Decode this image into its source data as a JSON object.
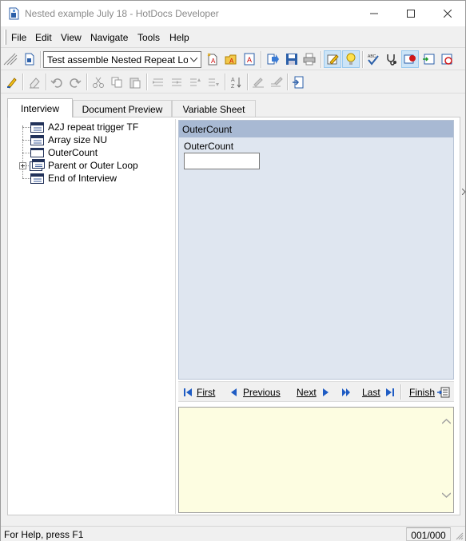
{
  "window": {
    "title": "Nested example July 18 - HotDocs Developer"
  },
  "menu": [
    "File",
    "Edit",
    "View",
    "Navigate",
    "Tools",
    "Help"
  ],
  "toolbar": {
    "assemble_combo_value": "Test assemble Nested Repeat Loo"
  },
  "tabs": [
    "Interview",
    "Document Preview",
    "Variable Sheet"
  ],
  "tree": {
    "items": [
      {
        "label": "A2J repeat trigger TF",
        "icon": "dialog-icon"
      },
      {
        "label": "Array size NU",
        "icon": "dialog-icon"
      },
      {
        "label": "OuterCount",
        "icon": "variable-icon"
      },
      {
        "label": "Parent or Outer Loop",
        "icon": "repeat-dialog-icon"
      },
      {
        "label": "End of Interview",
        "icon": "dialog-icon"
      }
    ]
  },
  "dialog": {
    "title": "OuterCount",
    "prompt": "OuterCount",
    "input_value": ""
  },
  "nav": {
    "first": "First",
    "previous": "Previous",
    "next": "Next",
    "last": "Last",
    "finish": "Finish"
  },
  "status": {
    "help_text": "For Help, press F1",
    "counter": "001/000"
  },
  "colors": {
    "dialog_header": "#a8b9d3",
    "dialog_body": "#dfe6f0",
    "help_pane": "#fdfde1",
    "nav_arrow": "#1f5cc4"
  }
}
